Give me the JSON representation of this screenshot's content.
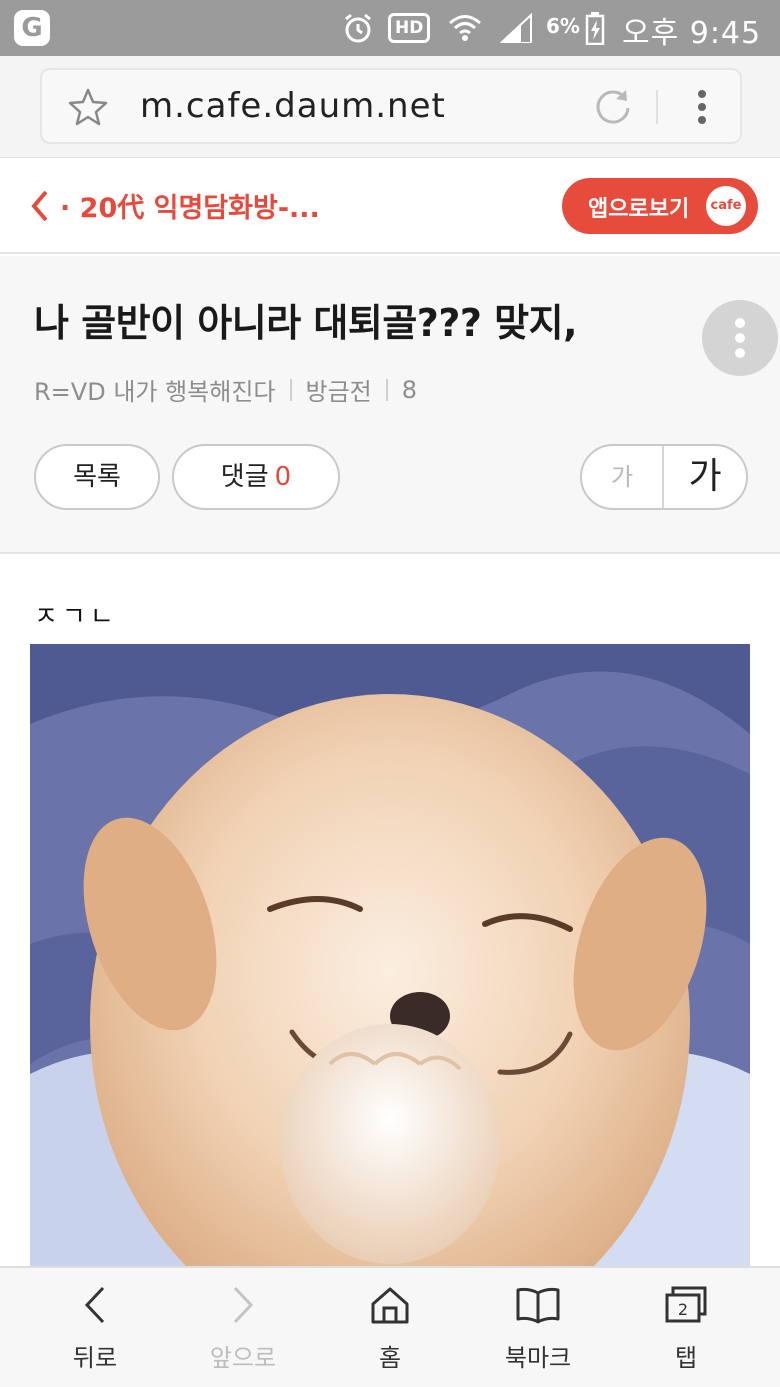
{
  "status_bar": {
    "app_badge": "G",
    "hd": "HD",
    "battery": "6%",
    "time": "오후 9:45",
    "icons": [
      "alarm-icon",
      "hd-icon",
      "wifi-icon",
      "signal-icon",
      "battery-charging-icon"
    ]
  },
  "browser": {
    "url": "m.cafe.daum.net",
    "icons": [
      "bookmark-star-icon",
      "reload-icon",
      "more-vertical-icon"
    ]
  },
  "cafe_header": {
    "cafe_name": "· 20代 익명담화방-...",
    "app_view_label": "앱으로보기",
    "cafe_logo": "cafe",
    "accent_color": "#e74b3c"
  },
  "post": {
    "title": "나 골반이 아니라 대퇴골??? 맞지,",
    "author": "R=VD 내가 행복해진다",
    "time": "방금전",
    "views": "8",
    "list_button": "목록",
    "comments_label": "댓글",
    "comments_count": "0",
    "font_small": "가",
    "font_large": "가",
    "body_text": "ㅈㄱㄴ",
    "image_alt": "웃는 강아지"
  },
  "bottom_nav": {
    "items": [
      {
        "label": "뒤로",
        "icon": "back-arrow-icon",
        "enabled": true
      },
      {
        "label": "앞으로",
        "icon": "forward-arrow-icon",
        "enabled": false
      },
      {
        "label": "홈",
        "icon": "home-icon",
        "enabled": true
      },
      {
        "label": "북마크",
        "icon": "bookmark-book-icon",
        "enabled": true
      },
      {
        "label": "탭",
        "icon": "tabs-icon",
        "enabled": true,
        "badge": "2"
      }
    ]
  }
}
